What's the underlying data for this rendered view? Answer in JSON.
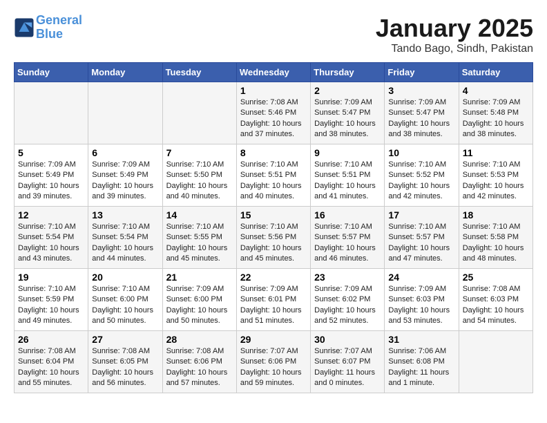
{
  "header": {
    "logo_line1": "General",
    "logo_line2": "Blue",
    "month": "January 2025",
    "location": "Tando Bago, Sindh, Pakistan"
  },
  "weekdays": [
    "Sunday",
    "Monday",
    "Tuesday",
    "Wednesday",
    "Thursday",
    "Friday",
    "Saturday"
  ],
  "weeks": [
    [
      {
        "day": "",
        "info": ""
      },
      {
        "day": "",
        "info": ""
      },
      {
        "day": "",
        "info": ""
      },
      {
        "day": "1",
        "info": "Sunrise: 7:08 AM\nSunset: 5:46 PM\nDaylight: 10 hours\nand 37 minutes."
      },
      {
        "day": "2",
        "info": "Sunrise: 7:09 AM\nSunset: 5:47 PM\nDaylight: 10 hours\nand 38 minutes."
      },
      {
        "day": "3",
        "info": "Sunrise: 7:09 AM\nSunset: 5:47 PM\nDaylight: 10 hours\nand 38 minutes."
      },
      {
        "day": "4",
        "info": "Sunrise: 7:09 AM\nSunset: 5:48 PM\nDaylight: 10 hours\nand 38 minutes."
      }
    ],
    [
      {
        "day": "5",
        "info": "Sunrise: 7:09 AM\nSunset: 5:49 PM\nDaylight: 10 hours\nand 39 minutes."
      },
      {
        "day": "6",
        "info": "Sunrise: 7:09 AM\nSunset: 5:49 PM\nDaylight: 10 hours\nand 39 minutes."
      },
      {
        "day": "7",
        "info": "Sunrise: 7:10 AM\nSunset: 5:50 PM\nDaylight: 10 hours\nand 40 minutes."
      },
      {
        "day": "8",
        "info": "Sunrise: 7:10 AM\nSunset: 5:51 PM\nDaylight: 10 hours\nand 40 minutes."
      },
      {
        "day": "9",
        "info": "Sunrise: 7:10 AM\nSunset: 5:51 PM\nDaylight: 10 hours\nand 41 minutes."
      },
      {
        "day": "10",
        "info": "Sunrise: 7:10 AM\nSunset: 5:52 PM\nDaylight: 10 hours\nand 42 minutes."
      },
      {
        "day": "11",
        "info": "Sunrise: 7:10 AM\nSunset: 5:53 PM\nDaylight: 10 hours\nand 42 minutes."
      }
    ],
    [
      {
        "day": "12",
        "info": "Sunrise: 7:10 AM\nSunset: 5:54 PM\nDaylight: 10 hours\nand 43 minutes."
      },
      {
        "day": "13",
        "info": "Sunrise: 7:10 AM\nSunset: 5:54 PM\nDaylight: 10 hours\nand 44 minutes."
      },
      {
        "day": "14",
        "info": "Sunrise: 7:10 AM\nSunset: 5:55 PM\nDaylight: 10 hours\nand 45 minutes."
      },
      {
        "day": "15",
        "info": "Sunrise: 7:10 AM\nSunset: 5:56 PM\nDaylight: 10 hours\nand 45 minutes."
      },
      {
        "day": "16",
        "info": "Sunrise: 7:10 AM\nSunset: 5:57 PM\nDaylight: 10 hours\nand 46 minutes."
      },
      {
        "day": "17",
        "info": "Sunrise: 7:10 AM\nSunset: 5:57 PM\nDaylight: 10 hours\nand 47 minutes."
      },
      {
        "day": "18",
        "info": "Sunrise: 7:10 AM\nSunset: 5:58 PM\nDaylight: 10 hours\nand 48 minutes."
      }
    ],
    [
      {
        "day": "19",
        "info": "Sunrise: 7:10 AM\nSunset: 5:59 PM\nDaylight: 10 hours\nand 49 minutes."
      },
      {
        "day": "20",
        "info": "Sunrise: 7:10 AM\nSunset: 6:00 PM\nDaylight: 10 hours\nand 50 minutes."
      },
      {
        "day": "21",
        "info": "Sunrise: 7:09 AM\nSunset: 6:00 PM\nDaylight: 10 hours\nand 50 minutes."
      },
      {
        "day": "22",
        "info": "Sunrise: 7:09 AM\nSunset: 6:01 PM\nDaylight: 10 hours\nand 51 minutes."
      },
      {
        "day": "23",
        "info": "Sunrise: 7:09 AM\nSunset: 6:02 PM\nDaylight: 10 hours\nand 52 minutes."
      },
      {
        "day": "24",
        "info": "Sunrise: 7:09 AM\nSunset: 6:03 PM\nDaylight: 10 hours\nand 53 minutes."
      },
      {
        "day": "25",
        "info": "Sunrise: 7:08 AM\nSunset: 6:03 PM\nDaylight: 10 hours\nand 54 minutes."
      }
    ],
    [
      {
        "day": "26",
        "info": "Sunrise: 7:08 AM\nSunset: 6:04 PM\nDaylight: 10 hours\nand 55 minutes."
      },
      {
        "day": "27",
        "info": "Sunrise: 7:08 AM\nSunset: 6:05 PM\nDaylight: 10 hours\nand 56 minutes."
      },
      {
        "day": "28",
        "info": "Sunrise: 7:08 AM\nSunset: 6:06 PM\nDaylight: 10 hours\nand 57 minutes."
      },
      {
        "day": "29",
        "info": "Sunrise: 7:07 AM\nSunset: 6:06 PM\nDaylight: 10 hours\nand 59 minutes."
      },
      {
        "day": "30",
        "info": "Sunrise: 7:07 AM\nSunset: 6:07 PM\nDaylight: 11 hours\nand 0 minutes."
      },
      {
        "day": "31",
        "info": "Sunrise: 7:06 AM\nSunset: 6:08 PM\nDaylight: 11 hours\nand 1 minute."
      },
      {
        "day": "",
        "info": ""
      }
    ]
  ]
}
